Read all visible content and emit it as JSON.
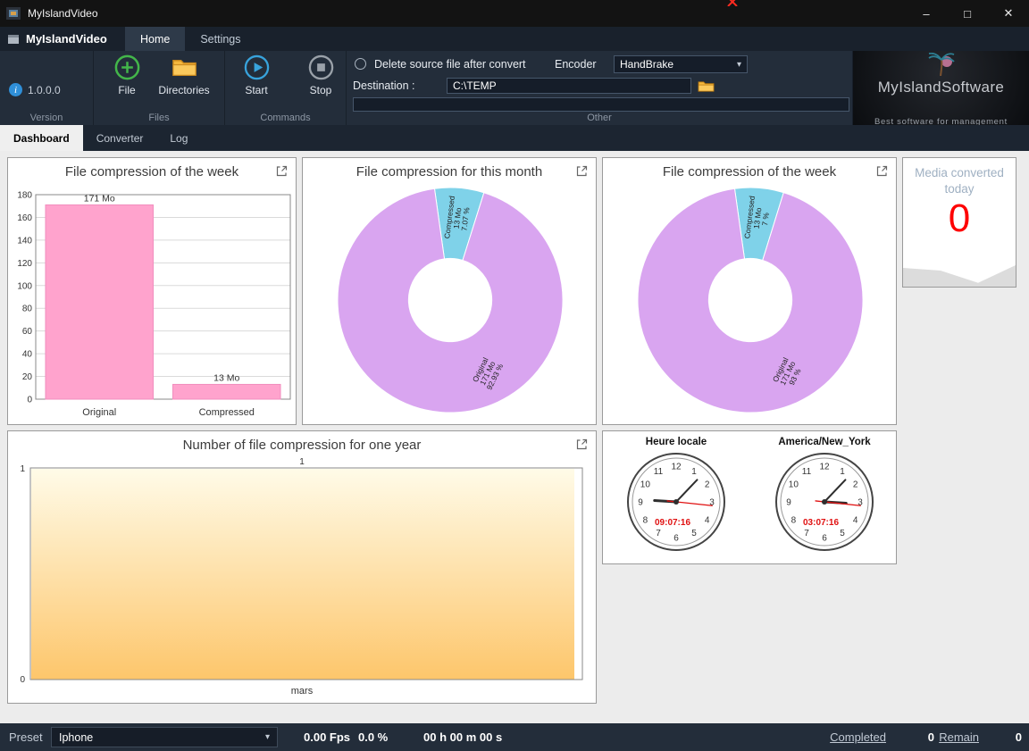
{
  "window": {
    "title": "MyIslandVideo",
    "brand": "MyIslandVideo",
    "menu_tabs": [
      {
        "label": "Home",
        "active": true
      },
      {
        "label": "Settings",
        "active": false
      }
    ]
  },
  "icons": {
    "minimize": "–",
    "maximize": "□",
    "close": "✕",
    "dropdown": "▾",
    "info": "i"
  },
  "ribbon": {
    "version": {
      "value": "1.0.0.0",
      "group_label": "Version"
    },
    "files": {
      "group_label": "Files",
      "buttons": [
        {
          "label": "File",
          "icon": "add-file-icon"
        },
        {
          "label": "Directories",
          "icon": "folder-icon"
        }
      ]
    },
    "commands": {
      "group_label": "Commands",
      "buttons": [
        {
          "label": "Start",
          "icon": "play-icon"
        },
        {
          "label": "Stop",
          "icon": "stop-icon"
        }
      ]
    },
    "other": {
      "group_label": "Other",
      "delete_checkbox_label": "Delete source file after convert",
      "delete_checkbox_checked": false,
      "encoder_label": "Encoder",
      "encoder_value": "HandBrake",
      "destination_label": "Destination :",
      "destination_value": "C:\\TEMP",
      "progress_percent": 0
    },
    "logo": {
      "title": "MyIslandSoftware",
      "tagline": "Best software for management"
    }
  },
  "view_tabs": [
    {
      "label": "Dashboard",
      "active": true
    },
    {
      "label": "Converter",
      "active": false
    },
    {
      "label": "Log",
      "active": false
    }
  ],
  "media_card": {
    "title": "Media converted today",
    "value": "0"
  },
  "clocks": {
    "local": {
      "title": "Heure locale",
      "time": "09:07:16",
      "h": 9,
      "m": 7,
      "s": 16
    },
    "newyork": {
      "title": "America/New_York",
      "time": "03:07:16",
      "h": 3,
      "m": 7,
      "s": 16
    }
  },
  "statusbar": {
    "preset_label": "Preset",
    "preset_value": "Iphone",
    "fps": "0.00 Fps",
    "percent": "0.0 %",
    "elapsed": "00 h 00 m 00 s",
    "completed_label": "Completed",
    "completed_value": "0",
    "remain_label": "Remain",
    "remain_value": "0"
  },
  "chart_data": [
    {
      "id": "week_bar",
      "type": "bar",
      "title": "File compression of the week",
      "categories": [
        "Original",
        "Compressed"
      ],
      "values": [
        171,
        13
      ],
      "value_labels": [
        "171 Mo",
        "13 Mo"
      ],
      "unit": "Mo",
      "ylim": [
        0,
        180
      ],
      "ytick_step": 20,
      "grid": true,
      "legend": "none",
      "bar_color": "#ffa3cd",
      "bar_border": "#f18ebe"
    },
    {
      "id": "month_donut",
      "type": "pie",
      "title": "File compression for this month",
      "hole_ratio": 0.37,
      "start_angle": -8,
      "slices": [
        {
          "name": "Compressed",
          "value": 7.07,
          "color": "#7fd2e9",
          "label_lines": [
            "Compressed",
            "13 Mo",
            "7.07 %"
          ],
          "label_angle": 5,
          "label_radius": 92,
          "label_rotate": -83
        },
        {
          "name": "Original",
          "value": 92.93,
          "color": "#d9a5f0",
          "label_lines": [
            "Original",
            "171 Mo",
            "92.93 %"
          ],
          "label_angle": 153,
          "label_radius": 92,
          "label_rotate": -64
        }
      ]
    },
    {
      "id": "week_donut",
      "type": "pie",
      "title": "File compression of the week",
      "hole_ratio": 0.37,
      "start_angle": -8,
      "slices": [
        {
          "name": "Compressed",
          "value": 7,
          "color": "#7fd2e9",
          "label_lines": [
            "Compressed",
            "13 Mo",
            "7 %"
          ],
          "label_angle": 5,
          "label_radius": 92,
          "label_rotate": -83
        },
        {
          "name": "Original",
          "value": 93,
          "color": "#d9a5f0",
          "label_lines": [
            "Original",
            "171 Mo",
            "93 %"
          ],
          "label_angle": 153,
          "label_radius": 92,
          "label_rotate": -64
        }
      ]
    },
    {
      "id": "year_area",
      "type": "area",
      "title": "Number of file compression for one year",
      "categories": [
        "mars"
      ],
      "values": [
        1
      ],
      "point_label": "1",
      "ylim": [
        0,
        1
      ],
      "fill_top": "#fffbe8",
      "fill_bottom": "#fdc66b"
    },
    {
      "id": "media_sparkline",
      "type": "area",
      "values": [
        0.5,
        0.42,
        0.06,
        0.58
      ],
      "fill": "#dcdcdc"
    }
  ]
}
